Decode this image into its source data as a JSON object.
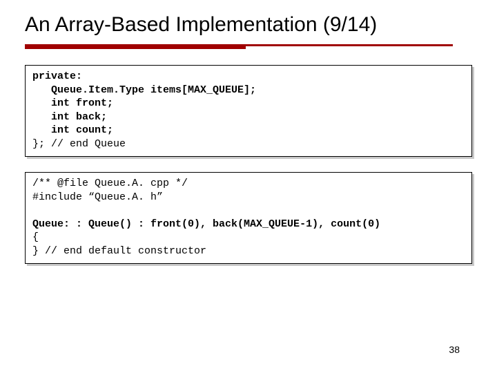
{
  "title": "An Array-Based Implementation (9/14)",
  "code1": {
    "l1": "private:",
    "l2": "   Queue.Item.Type items[MAX_QUEUE];",
    "l3": "   int front;",
    "l4": "   int back;",
    "l5": "   int count;",
    "l6": "}; // end Queue"
  },
  "code2": {
    "l1": "/** @file Queue.A. cpp */",
    "l2": "#include “Queue.A. h”",
    "l3": "",
    "l4": "Queue: : Queue() : front(0), back(MAX_QUEUE-1), count(0)",
    "l5": "{",
    "l6": "} // end default constructor"
  },
  "pageNumber": "38"
}
